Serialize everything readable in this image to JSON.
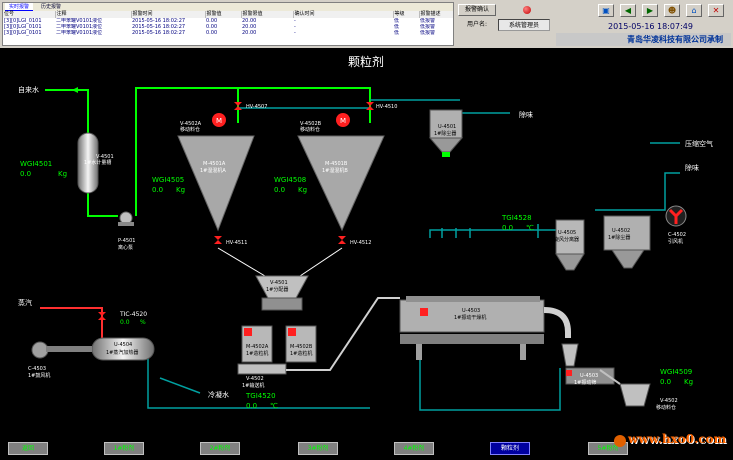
{
  "alarm_panel": {
    "tabs": [
      "实时报警",
      "历史报警"
    ],
    "columns": [
      "位号",
      "注释",
      "报警时间",
      "报警值",
      "报警限值",
      "确认时间",
      "等级",
      "报警描述"
    ],
    "rows": [
      [
        "[3][0]LGI_0101",
        "二甲苯罐V0101液位",
        "2015-05-16 18:02:27",
        "0.00",
        "20.00",
        "-",
        "低",
        "低报警"
      ],
      [
        "[3][0]LGI_0101",
        "二甲苯罐V0101液位",
        "2015-05-16 18:02:27",
        "0.00",
        "20.00",
        "-",
        "低",
        "低报警"
      ],
      [
        "[3][0]LGI_0101",
        "二甲苯罐V0101液位",
        "2015-05-16 18:02:27",
        "0.00",
        "20.00",
        "-",
        "低",
        "低报警"
      ]
    ]
  },
  "header": {
    "ack_label": "报警确认",
    "user_label": "用户名:",
    "user_name": "系统管理员",
    "clock": "2015-05-16 18:07:49",
    "company": "青岛华凌科技有限公司承制"
  },
  "diagram": {
    "title": "颗粒剂",
    "inlet_water": "自来水",
    "steam": "蒸汽",
    "cooling_water": "冷凝水",
    "exhaust1": "除味",
    "exhaust2": "除味",
    "compressed_air": "压缩空气",
    "tank_v4501": "V-4501\n1#水计量槽",
    "pump_p4501": "P-4501\n离心泵",
    "wgi4501": "WGI4501",
    "wgi4501_value": "0.0",
    "wgi4501_unit": "Kg",
    "wgi4505": "WGI4505",
    "wgi4505_value": "0.0",
    "wgi4505_unit": "Kg",
    "wgi4508": "WGI4508",
    "wgi4508_value": "0.0",
    "wgi4508_unit": "Kg",
    "hopper_a_tag": "V-4502A",
    "hopper_a_sub": "移动料仓",
    "hopper_b_tag": "V-4502B",
    "hopper_b_sub": "移动料仓",
    "mixer_a_tag": "M-4501A",
    "mixer_a_sub": "1#湿混机A",
    "mixer_b_tag": "M-4501B",
    "mixer_b_sub": "1#湿混机B",
    "hv4507": "HV-4507",
    "hv4510": "HV-4510",
    "hv4511": "HV-4511",
    "hv4512": "HV-4512",
    "distributor_tag": "V-4501",
    "distributor_sub": "1#分配器",
    "granulator_a_tag": "M-4502A",
    "granulator_a_sub": "1#造粒机",
    "granulator_b_tag": "M-4502B",
    "granulator_b_sub": "1#造粒机",
    "conveyor_tag": "V-4502",
    "conveyor_sub": "1#输送机",
    "tic4520": "TIC-4520",
    "tic4520_value": "0.0",
    "tic4520_unit": "%",
    "heater_tag": "U-4504",
    "heater_sub": "1#蒸汽加热器",
    "fan_c4503_tag": "C-4503",
    "fan_c4503_sub": "1#鼓风机",
    "tgi4520": "TGI4520",
    "tgi4520_value": "0.0",
    "tgi4520_unit": "℃",
    "dryer_tag": "U-4503",
    "dryer_sub": "1#振动干燥机",
    "tgi4528": "TGI4528",
    "tgi4528_value": "0.0",
    "tgi4528_unit": "℃",
    "cyclone_tag": "U-4505",
    "cyclone_sub": "旋风分离器",
    "dust_a_tag": "U-4501",
    "dust_a_sub": "1#除尘器",
    "dust_b_tag": "U-4502",
    "dust_b_sub": "1#除尘器",
    "fan_c4502_tag": "C-4502",
    "fan_c4502_sub": "引风机",
    "sieve_tag": "U-4503",
    "sieve_sub": "1#振动筛",
    "wgi4509": "WGI4509",
    "wgi4509_value": "0.0",
    "wgi4509_unit": "Kg",
    "bin_tag": "V-4502",
    "bin_sub": "移动料仓"
  },
  "nav": {
    "tabs": [
      "返回",
      "1#粉剂",
      "2#粉剂",
      "3#粉剂",
      "4#粉剂",
      "颗粒剂",
      "5#粉剂"
    ],
    "active_index": 5
  },
  "watermark": "www.hxo0.com",
  "colors": {
    "water_pipe": "#00ff00",
    "steam_pipe": "#ff3030",
    "air_pipe": "#00a0a0",
    "equipment": "#a8a8a8",
    "valve_red": "#ff2020",
    "value_green": "#00ff00",
    "banner_blue": "#003399"
  }
}
